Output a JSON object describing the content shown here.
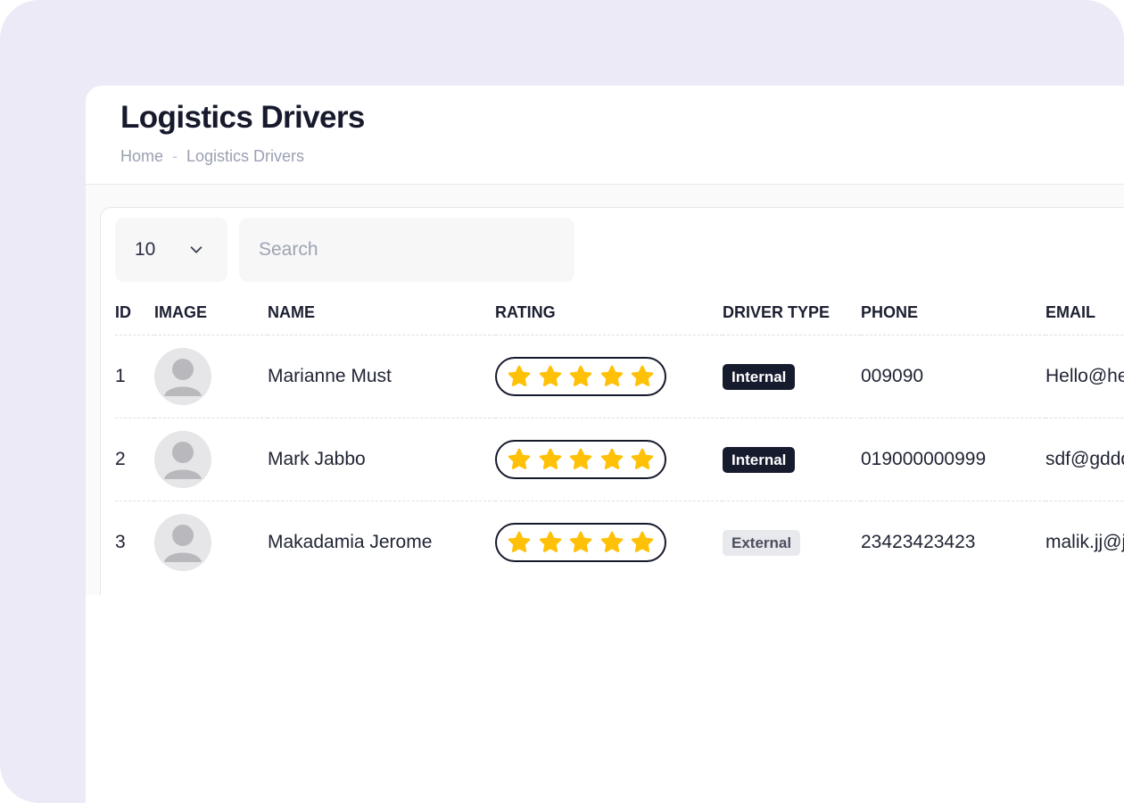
{
  "header": {
    "title": "Logistics Drivers",
    "breadcrumb": [
      "Home",
      "Logistics Drivers"
    ]
  },
  "toolbar": {
    "page_size": "10",
    "search_placeholder": "Search"
  },
  "table": {
    "columns": [
      "ID",
      "IMAGE",
      "NAME",
      "RATING",
      "DRIVER TYPE",
      "PHONE",
      "EMAIL"
    ],
    "rows": [
      {
        "id": "1",
        "name": "Marianne Must",
        "rating": 5,
        "driver_type": "Internal",
        "phone": "009090",
        "email": "Hello@hello.com"
      },
      {
        "id": "2",
        "name": "Mark Jabbo",
        "rating": 5,
        "driver_type": "Internal",
        "phone": "019000000999",
        "email": "sdf@gddd.com"
      },
      {
        "id": "3",
        "name": "Makadamia Jerome",
        "rating": 5,
        "driver_type": "External",
        "phone": "23423423423",
        "email": "malik.jj@jj.com"
      }
    ]
  },
  "colors": {
    "star": "#FFC107",
    "badge_internal_bg": "#171B2E",
    "badge_external_bg": "#E8E9EC",
    "frame_bg": "#EBEAF6"
  },
  "icons": {
    "page_size_toggle": "chevron-down-icon",
    "avatar": "user-placeholder-icon",
    "rating": "star-icon"
  }
}
